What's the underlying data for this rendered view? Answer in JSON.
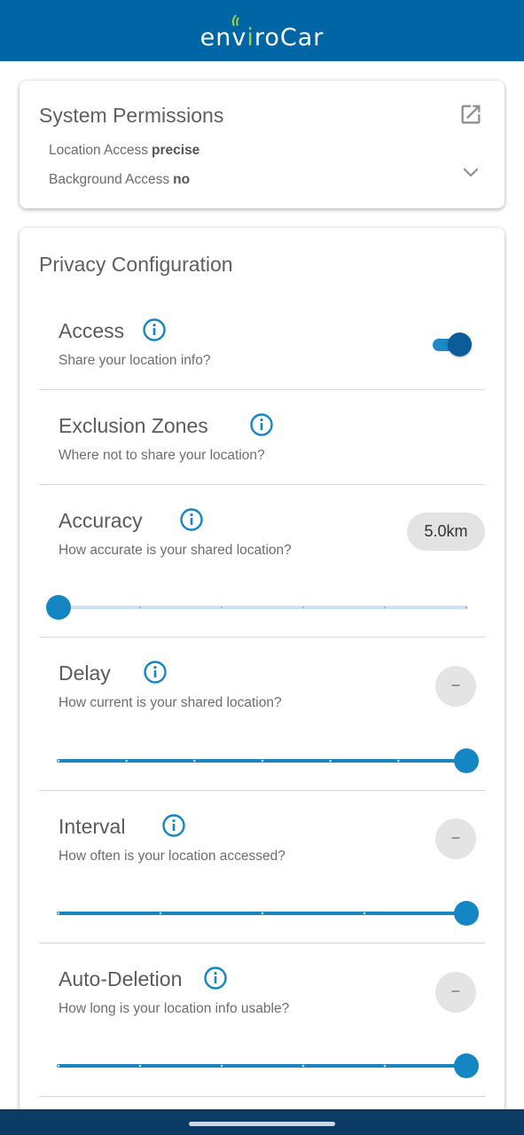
{
  "app": {
    "logo_before": "env",
    "logo_i": "i",
    "logo_after": "roCar",
    "brand_color": "#0065a4",
    "accent_color": "#a4cf4a"
  },
  "permissions": {
    "title": "System Permissions",
    "location_label": "Location Access",
    "location_value": "precise",
    "background_label": "Background Access",
    "background_value": "no",
    "open_icon": "open-in-new-icon",
    "expand_icon": "chevron-down-icon"
  },
  "privacy": {
    "title": "Privacy Configuration",
    "access": {
      "title": "Access",
      "subtitle": "Share your location info?",
      "enabled": true
    },
    "exclusion": {
      "title": "Exclusion Zones",
      "subtitle": "Where not to share your location?"
    },
    "accuracy": {
      "title": "Accuracy",
      "subtitle": "How accurate is your shared location?",
      "chip": "5.0km",
      "slider_value": 0
    },
    "delay": {
      "title": "Delay",
      "subtitle": "How current is your shared location?",
      "button": "–",
      "slider_value": 1
    },
    "interval": {
      "title": "Interval",
      "subtitle": "How often is your location accessed?",
      "button": "–",
      "slider_value": 1
    },
    "autodeletion": {
      "title": "Auto-Deletion",
      "subtitle": "How long is your location info usable?",
      "button": "–",
      "slider_value": 1
    },
    "info_icon": "info-icon"
  },
  "colors": {
    "slider_active": "#1b84bf",
    "slider_inactive": "#cde4f0",
    "thumb": "#1586c4",
    "navbar": "#0c3c66"
  }
}
